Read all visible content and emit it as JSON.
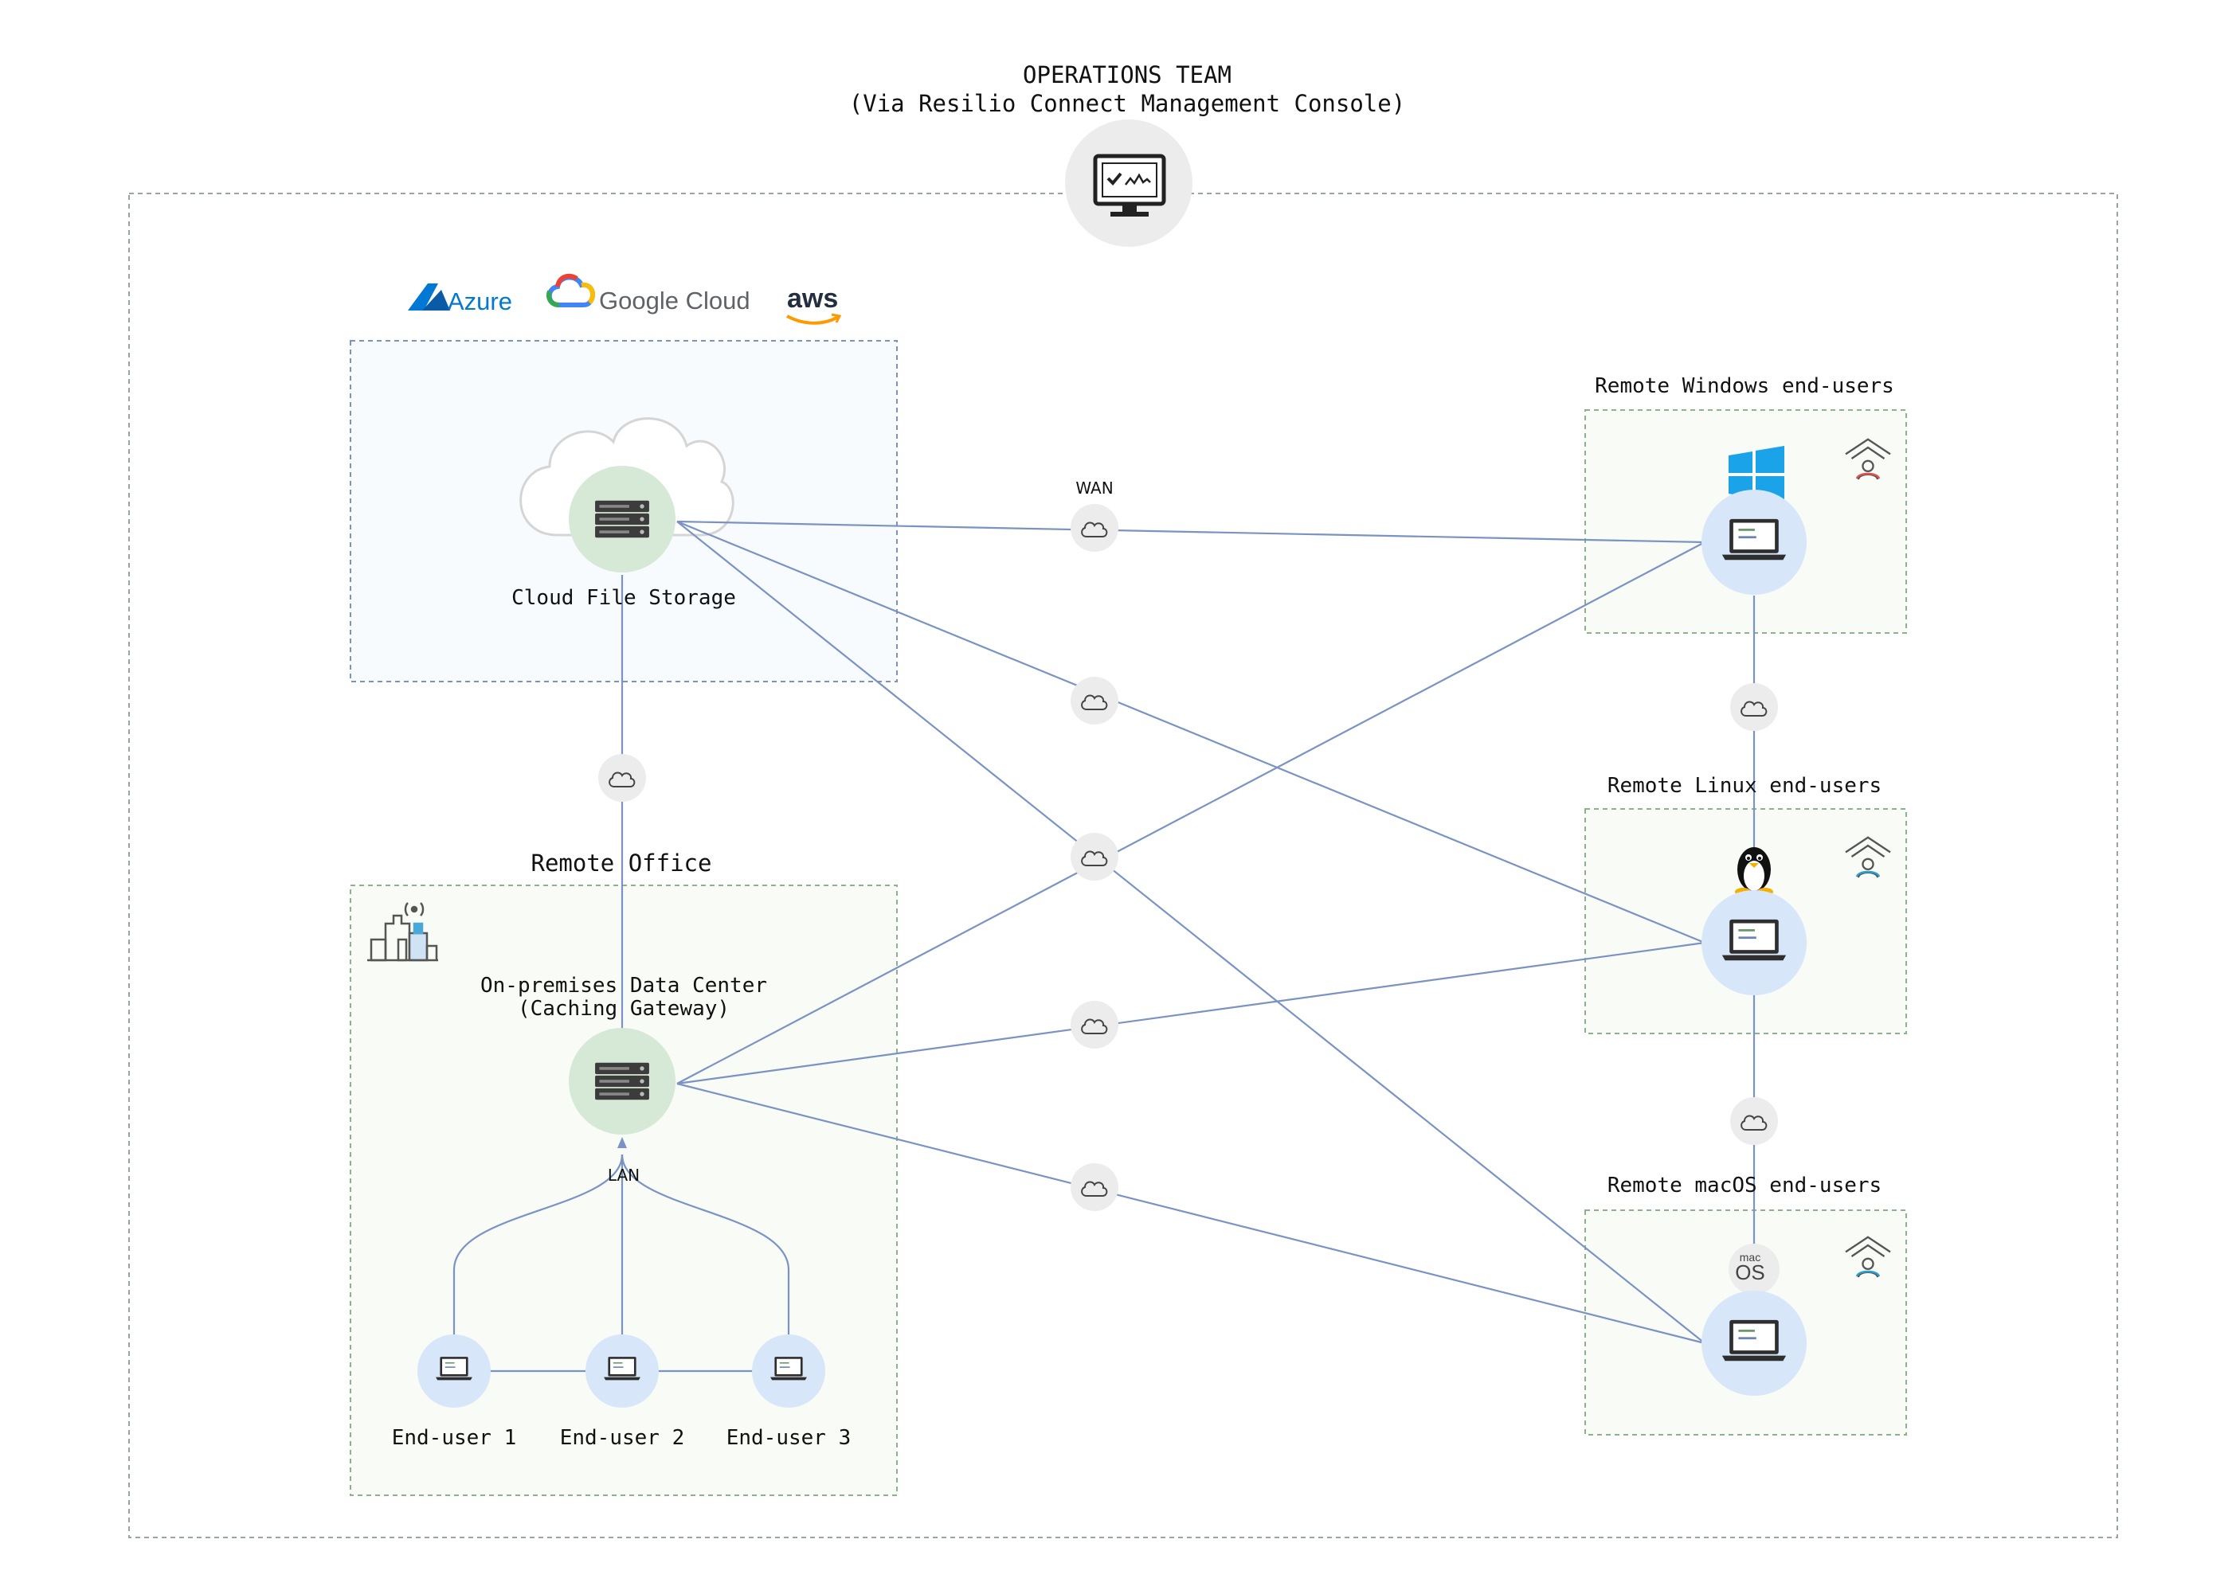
{
  "header": {
    "title": "OPERATIONS TEAM",
    "subtitle": "(Via Resilio Connect Management Console)"
  },
  "cloud_providers": {
    "azure": "Azure",
    "google": "Google Cloud",
    "aws": "aws"
  },
  "cloud_storage": {
    "label": "Cloud File Storage"
  },
  "wan": {
    "label": "WAN"
  },
  "remote_office": {
    "title": "Remote Office",
    "datacenter_line1": "On-premises Data Center",
    "datacenter_line2": "(Caching Gateway)",
    "lan_label": "LAN",
    "end_users": [
      "End-user 1",
      "End-user 2",
      "End-user 3"
    ]
  },
  "remote_groups": {
    "windows": "Remote Windows end-users",
    "linux": "Remote Linux end-users",
    "macos": "Remote macOS end-users"
  },
  "macos_logo": {
    "line1": "mac",
    "line2": "OS"
  },
  "colors": {
    "link": "#7a93c4",
    "server_circle": "#d6e8d6",
    "laptop_circle": "#d7e6f8",
    "relay_circle": "#ececec",
    "azure": "#0078d4",
    "windows": "#1aa3e8",
    "aws_smile": "#ff9900"
  }
}
